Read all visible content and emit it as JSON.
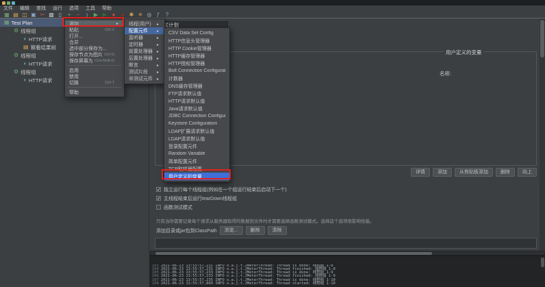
{
  "titlebar": {
    "icons": [
      {
        "name": "jmeter-app-icon",
        "color": "#d8a657"
      },
      {
        "name": "document-icon",
        "color": "#6aab73"
      },
      {
        "name": "window-icon",
        "color": "#61afc1"
      }
    ]
  },
  "menubar": [
    "文件",
    "编辑",
    "查找",
    "运行",
    "选项",
    "工具",
    "帮助"
  ],
  "toolbar": [
    {
      "name": "new-plan-icon",
      "glyph": "▦",
      "color": "#7aa874"
    },
    {
      "name": "templates-icon",
      "glyph": "▤",
      "color": "#d8a657"
    },
    {
      "name": "open-file-icon",
      "glyph": "◫",
      "color": "#d8a657"
    },
    {
      "name": "save-icon",
      "glyph": "▣",
      "color": "#8aa8c7"
    },
    {
      "name": "cut-icon",
      "glyph": "✂",
      "color": "#c75450"
    },
    {
      "name": "copy-icon",
      "glyph": "▩",
      "color": "#b6bcc2"
    },
    {
      "name": "paste-icon",
      "glyph": "▯",
      "color": "#b6bcc2"
    },
    {
      "name": "expand-all-icon",
      "glyph": "+",
      "color": "#7aa874"
    },
    {
      "name": "collapse-all-icon",
      "glyph": "−",
      "color": "#c75450"
    },
    {
      "name": "toggle-icon",
      "glyph": "↕",
      "color": "#b6bcc2"
    },
    {
      "name": "start-icon",
      "glyph": "▶",
      "color": "#5fad65"
    },
    {
      "name": "start-no-pauses-icon",
      "glyph": "▶",
      "color": "#2f6f35"
    },
    {
      "name": "stop-icon",
      "glyph": "●",
      "color": "#d24b44"
    },
    {
      "name": "shutdown-icon",
      "glyph": "●",
      "color": "#8e2f2a"
    },
    {
      "name": "clear-icon",
      "glyph": "✱",
      "color": "#d8a657"
    },
    {
      "name": "clear-all-icon",
      "glyph": "✳",
      "color": "#d8a657"
    },
    {
      "name": "search-icon",
      "glyph": "◎",
      "color": "#b6bcc2"
    },
    {
      "name": "function-helper-icon",
      "glyph": "ƒ",
      "color": "#8aa8c7"
    },
    {
      "name": "help-icon",
      "glyph": "?",
      "color": "#8aa8c7"
    }
  ],
  "tree": [
    {
      "label": "Test Plan",
      "depth": 0,
      "icon": "test-plan-icon",
      "glyph": "▦",
      "color": "#7aa874",
      "state": "selected"
    },
    {
      "label": "线程组",
      "depth": 1,
      "icon": "thread-group-icon",
      "glyph": "⚙",
      "color": "#6aab73"
    },
    {
      "label": "HTTP请求",
      "depth": 2,
      "icon": "http-request-icon",
      "glyph": "◗",
      "color": "#61afc1"
    },
    {
      "label": "察看结果树",
      "depth": 2,
      "icon": "listener-icon",
      "glyph": "▤",
      "color": "#d8a657"
    },
    {
      "label": "线程组",
      "depth": 1,
      "icon": "thread-group-icon",
      "glyph": "⚙",
      "color": "#6aab73"
    },
    {
      "label": "HTTP请求",
      "depth": 2,
      "icon": "http-request-icon",
      "glyph": "◗",
      "color": "#61afc1"
    },
    {
      "label": "线程组",
      "depth": 1,
      "icon": "thread-group-icon",
      "glyph": "⚙",
      "color": "#6aab73"
    },
    {
      "label": "HTTP请求",
      "depth": 2,
      "icon": "http-request-icon",
      "glyph": "◗",
      "color": "#61afc1"
    }
  ],
  "context_menu": [
    {
      "label": "添加",
      "submenu": true,
      "state": "hover"
    },
    {
      "label": "粘贴",
      "shortcut": "Ctrl-V"
    },
    {
      "label": "打开..."
    },
    {
      "label": "合并"
    },
    {
      "label": "选中部分保存为..."
    },
    {
      "label": "保存节点为图片",
      "shortcut": "Ctrl-G"
    },
    {
      "label": "保存屏幕为图片",
      "shortcut": "Ctrl+Shift-G"
    },
    {
      "state": "separator"
    },
    {
      "label": "启用"
    },
    {
      "label": "禁用"
    },
    {
      "label": "切换",
      "shortcut": "Ctrl-T"
    },
    {
      "state": "separator"
    },
    {
      "label": "帮助"
    }
  ],
  "add_submenu": [
    {
      "label": "线程(用户)",
      "submenu": true
    },
    {
      "label": "配置元件",
      "submenu": true,
      "state": "hover"
    },
    {
      "label": "监听器",
      "submenu": true
    },
    {
      "label": "定时器",
      "submenu": true
    },
    {
      "label": "前置处理器",
      "submenu": true
    },
    {
      "label": "后置处理器",
      "submenu": true
    },
    {
      "label": "断言",
      "submenu": true
    },
    {
      "label": "测试片段",
      "submenu": true
    },
    {
      "label": "非测试元件",
      "submenu": true
    }
  ],
  "config_submenu": [
    {
      "label": "CSV Data Set Config"
    },
    {
      "label": "HTTP信息头管理器"
    },
    {
      "label": "HTTP Cookie管理器"
    },
    {
      "label": "HTTP缓存管理器"
    },
    {
      "label": "HTTP授权管理器"
    },
    {
      "label": "Bolt Connection Configuration"
    },
    {
      "label": "计数器"
    },
    {
      "label": "DNS缓存管理器"
    },
    {
      "label": "FTP请求默认值"
    },
    {
      "label": "HTTP请求默认值"
    },
    {
      "label": "Java请求默认值"
    },
    {
      "label": "JDBC Connection Configuration"
    },
    {
      "label": "Keystore Configuration"
    },
    {
      "label": "LDAP扩展请求默认值"
    },
    {
      "label": "LDAP请求默认值"
    },
    {
      "label": "登录配置元件"
    },
    {
      "label": "Random Variable"
    },
    {
      "label": "简单配置元件"
    },
    {
      "label": "TCP取样器配置"
    },
    {
      "label": "用户定义的变量",
      "state": "hover"
    }
  ],
  "main": {
    "title_field": "测试计划",
    "udv_section_title": "用户定义的变量",
    "udv_name_label": "名称:",
    "udv_buttons": [
      {
        "name": "detail-button",
        "label": "详情"
      },
      {
        "name": "add-button",
        "label": "添加"
      },
      {
        "name": "add-from-clipboard-button",
        "label": "从剪贴板添加"
      },
      {
        "name": "delete-button",
        "label": "删除"
      },
      {
        "name": "up-button",
        "label": "向上"
      }
    ],
    "checkboxes": [
      {
        "name": "run-threadgroups-consecutively-checkbox",
        "label": "独立运行每个线程组(例如在一个组运行结束后启动下一个)",
        "checked": true
      },
      {
        "name": "run-teardown-checkbox",
        "label": "主线程结束后运行tearDown线程组",
        "checked": true
      },
      {
        "name": "functional-mode-checkbox",
        "label": "函数测试模式",
        "checked": false
      }
    ],
    "function_mode_note": "只有当你需要记录每个请求从服务器取得的数据到文件时才需要选择函数测试模式。选择这个选项很影响性能。",
    "classpath_label": "添加目录或jar包到ClassPath",
    "classpath_buttons": [
      {
        "name": "browse-button",
        "label": "浏览..."
      },
      {
        "name": "delete-jar-button",
        "label": "删除"
      },
      {
        "name": "clear-jar-button",
        "label": "清除"
      }
    ]
  },
  "log": {
    "lines": [
      {
        "num": "103",
        "text": "2021-06-23 13:55:57,231 INFO o.a.j.t.JMeterThread: Thread is done: 线程组 1-8"
      },
      {
        "num": "104",
        "text": "2021-06-23 13:55:57,231 INFO o.a.j.t.JMeterThread: Thread finished: 线程组 1-8"
      },
      {
        "num": "105",
        "text": "2021-06-23 13:55:57,233 INFO o.a.j.t.JMeterThread: Thread is done: 线程组 1-9"
      },
      {
        "num": "106",
        "text": "2021-06-23 13:55:57,233 INFO o.a.j.t.JMeterThread: Thread finished: 线程组 1-9"
      },
      {
        "num": "107",
        "text": "2021-06-23 13:55:57,235 INFO o.a.j.t.JMeterThread: Thread is done: 线程组 1-10"
      },
      {
        "num": "108",
        "text": "2021-06-23 13:55:57,860 INFO o.a.j.t.JMeterThread: Thread started: 线程组 1-10"
      }
    ]
  },
  "colors": {
    "annotation_red": "#e2211c",
    "selection_blue": "#3f6fd6",
    "panel_bg": "#3c3f41",
    "log_bg": "#232425"
  }
}
